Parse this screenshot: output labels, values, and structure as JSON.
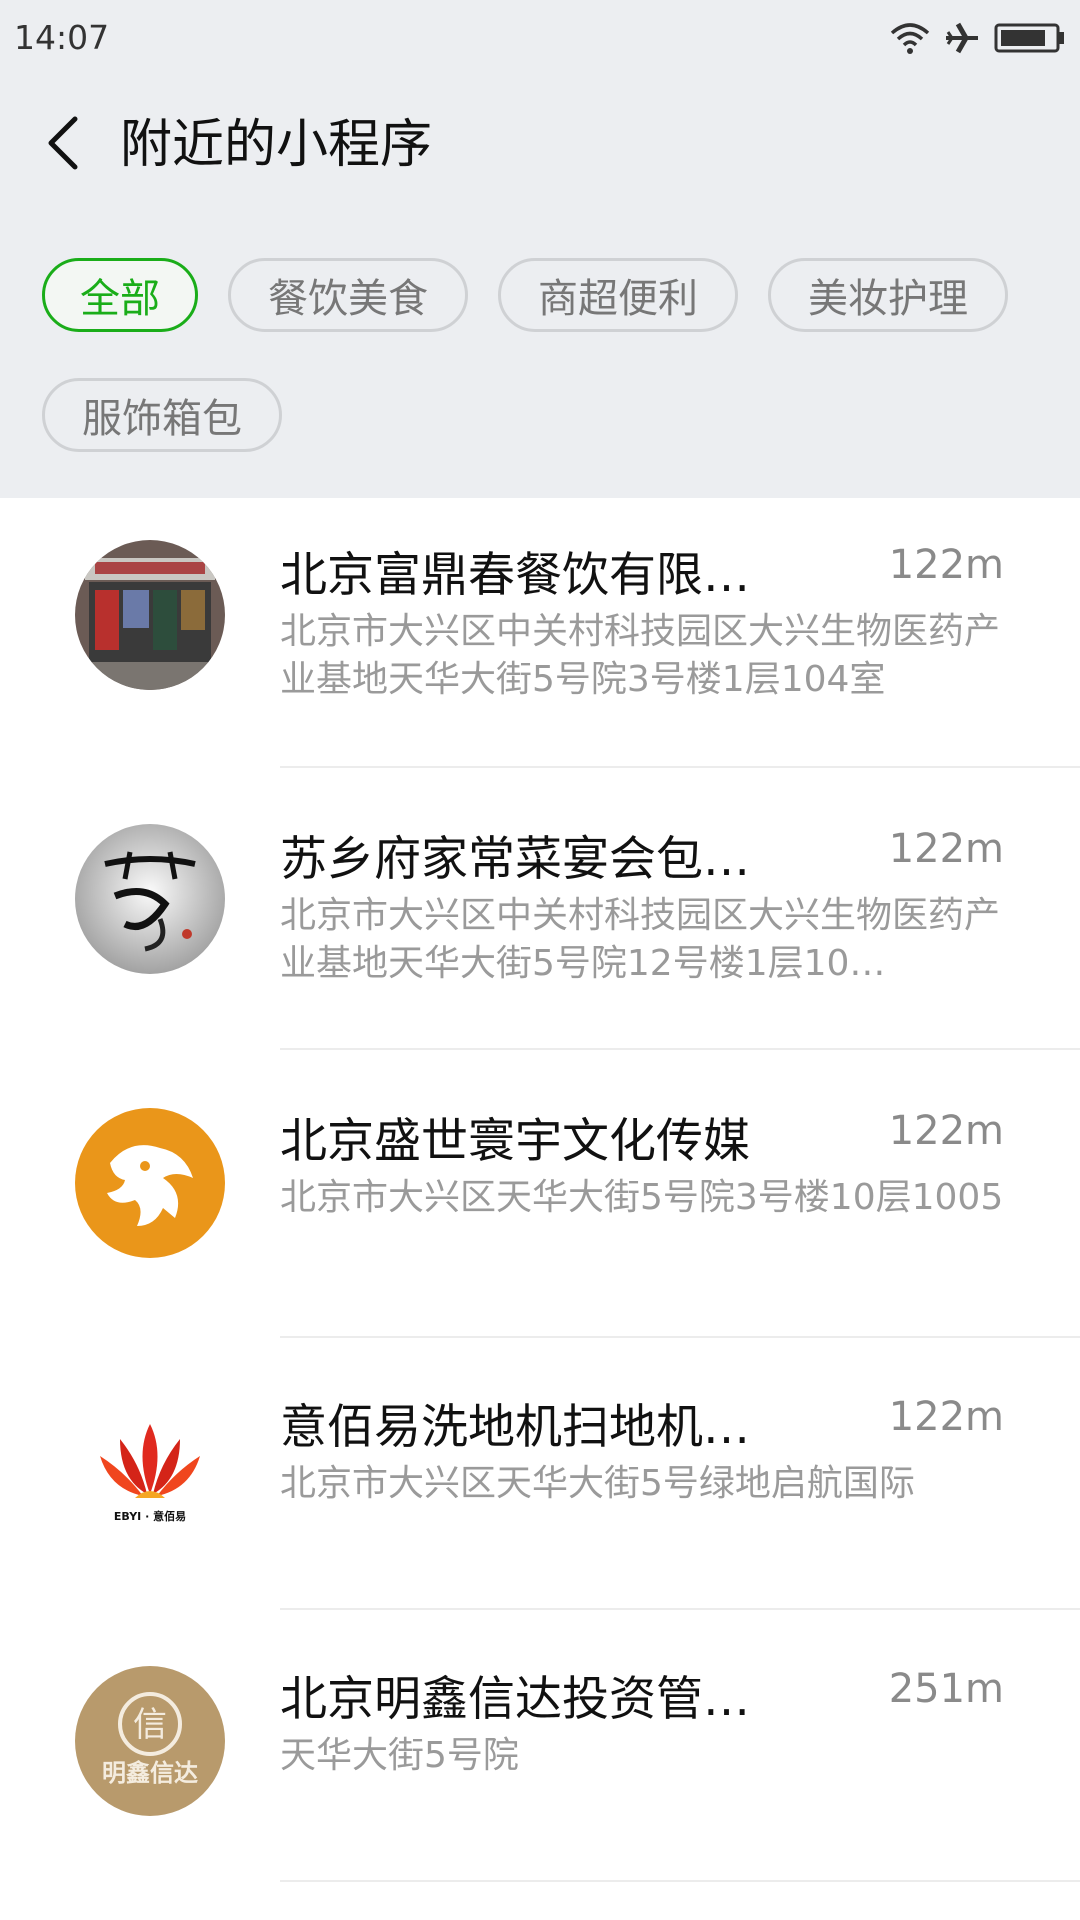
{
  "status_bar": {
    "time": "14:07",
    "icons": [
      "wifi-icon",
      "airplane-icon",
      "battery-icon"
    ]
  },
  "nav": {
    "back_icon": "chevron-left-icon",
    "title": "附近的小程序"
  },
  "filters": [
    {
      "label": "全部",
      "active": true
    },
    {
      "label": "餐饮美食",
      "active": false
    },
    {
      "label": "商超便利",
      "active": false
    },
    {
      "label": "美妆护理",
      "active": false
    },
    {
      "label": "服饰箱包",
      "active": false
    }
  ],
  "colors": {
    "accent": "#1aad19",
    "header_bg": "#eceef1"
  },
  "items": [
    {
      "name": "北京富鼎春餐饮有限…",
      "distance": "122m",
      "address": "北京市大兴区中关村科技园区大兴生物医药产业基地天华大街5号院3号楼1层104室",
      "avatar": "storefront-photo"
    },
    {
      "name": "苏乡府家常菜宴会包…",
      "distance": "122m",
      "address": "北京市大兴区中关村科技园区大兴生物医药产业基地天华大街5号院12号楼1层10…",
      "avatar": "calligraphy-logo"
    },
    {
      "name": "北京盛世寰宇文化传媒",
      "distance": "122m",
      "address": "北京市大兴区天华大街5号院3号楼10层1005",
      "avatar": "dragon-logo"
    },
    {
      "name": "意佰易洗地机扫地机…",
      "distance": "122m",
      "address": "北京市大兴区天华大街5号绿地启航国际",
      "avatar": "ebyi-lotus-logo",
      "logo_text": "EBYI · 意佰易"
    },
    {
      "name": "北京明鑫信达投资管…",
      "distance": "251m",
      "address": "天华大街5号院",
      "avatar": "mingxin-logo",
      "logo_text": "明鑫信达",
      "logo_char": "信"
    }
  ]
}
